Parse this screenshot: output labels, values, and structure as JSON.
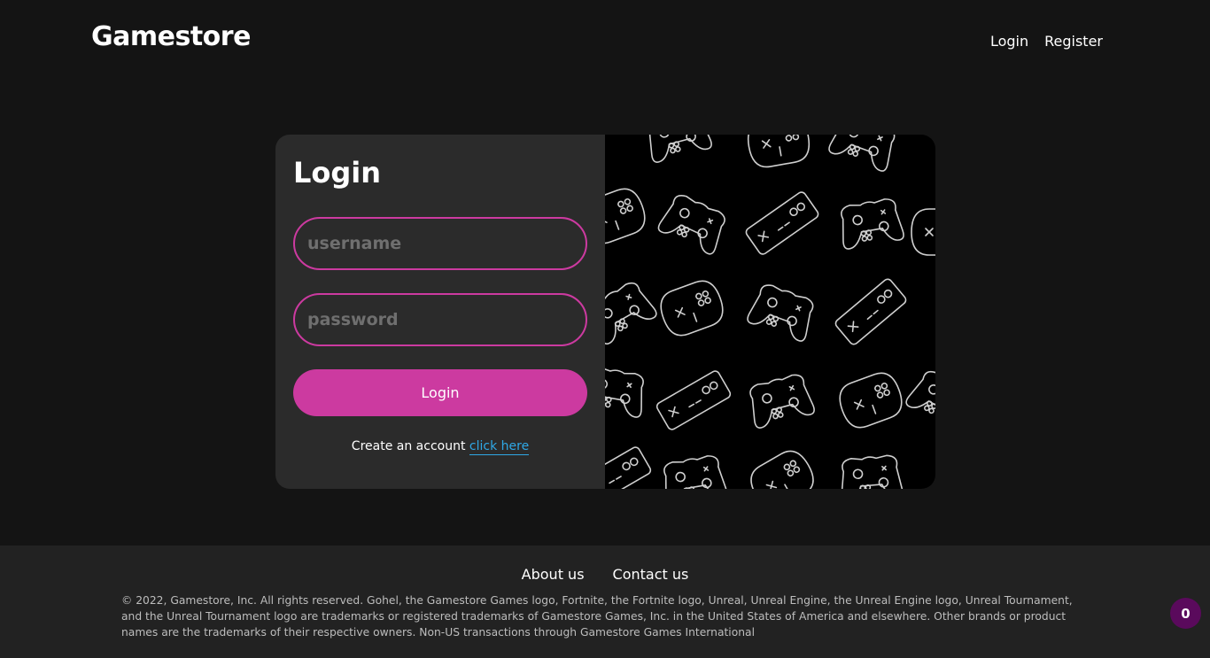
{
  "header": {
    "brand": "Gamestore",
    "nav": {
      "login": "Login",
      "register": "Register"
    }
  },
  "login_card": {
    "title": "Login",
    "username": {
      "value": "",
      "placeholder": "username"
    },
    "password": {
      "value": "",
      "placeholder": "password"
    },
    "submit_label": "Login",
    "create_account_text": "Create an account",
    "create_account_link": "click here",
    "pattern_icon": "gamepad-pattern"
  },
  "footer": {
    "links": {
      "about": "About us",
      "contact": "Contact us"
    },
    "legal": "© 2022, Gamestore, Inc. All rights reserved. Gohel, the Gamestore Games logo, Fortnite, the Fortnite logo, Unreal, Unreal Engine, the Unreal Engine logo, Unreal Tournament, and the Unreal Tournament logo are trademarks or registered trademarks of Gamestore Games, Inc. in the United States of America and elsewhere. Other brands or product names are the trademarks of their respective owners. Non-US transactions through Gamestore Games International"
  },
  "cart": {
    "count": "0"
  },
  "colors": {
    "accent": "#cc3aa0",
    "link": "#2fa8e6",
    "page_bg": "#141414",
    "card_bg": "#2b2b2b",
    "footer_bg": "#222222",
    "badge_bg": "#5a0a5c"
  }
}
